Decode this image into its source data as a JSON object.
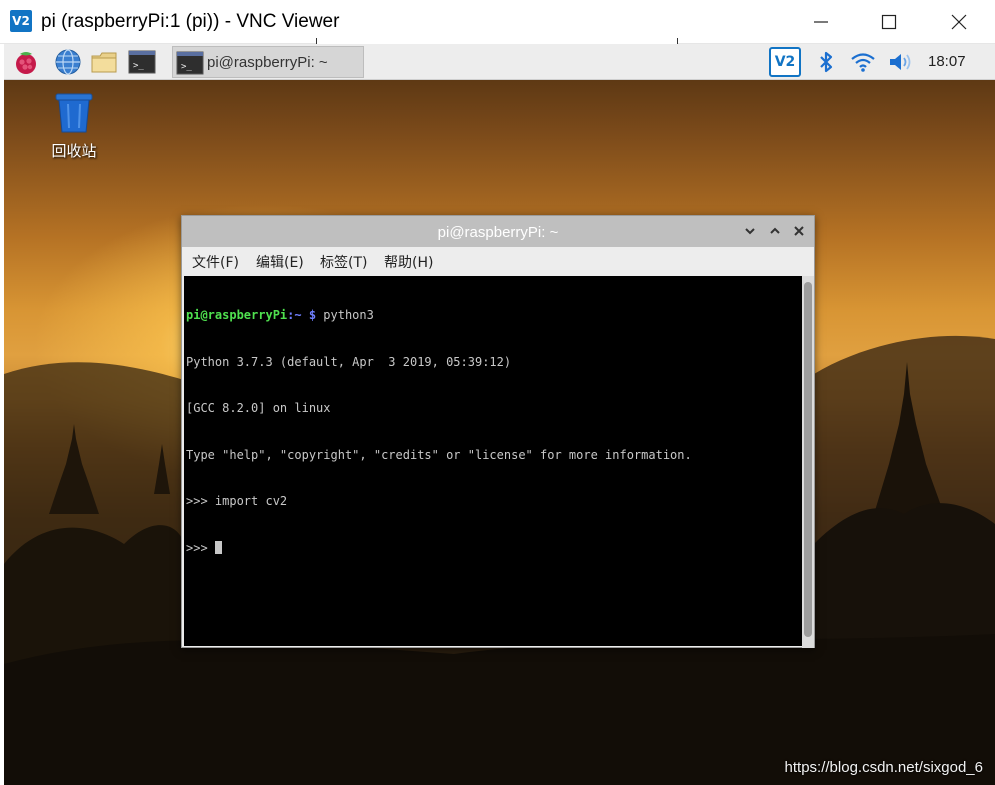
{
  "vnc": {
    "logo": "V2",
    "title": "pi (raspberryPi:1 (pi)) - VNC Viewer"
  },
  "taskbar": {
    "icons": [
      "raspberry-menu-icon",
      "browser-globe-icon",
      "file-manager-icon",
      "terminal-icon"
    ],
    "task_label": "pi@raspberryPi: ~",
    "tray_vnc": "V2",
    "tray_icons": [
      "bluetooth-icon",
      "wifi-icon",
      "volume-icon"
    ],
    "clock": "18:07"
  },
  "desktop": {
    "trash_label": "回收站"
  },
  "terminal": {
    "title": "pi@raspberryPi: ~",
    "menu": [
      "文件(F)",
      "编辑(E)",
      "标签(T)",
      "帮助(H)"
    ],
    "prompt_user": "pi@raspberryPi",
    "prompt_path": ":~ $",
    "command": " python3",
    "lines": [
      "Python 3.7.3 (default, Apr  3 2019, 05:39:12)",
      "[GCC 8.2.0] on linux",
      "Type \"help\", \"copyright\", \"credits\" or \"license\" for more information.",
      ">>> import cv2"
    ],
    "current_prompt": ">>> "
  },
  "watermark": "https://blog.csdn.net/sixgod_6",
  "colors": {
    "vnc_blue": "#1174c4",
    "prompt_green": "#4fe04f",
    "prompt_blue": "#6f7fff",
    "terminal_bg": "#000000"
  }
}
